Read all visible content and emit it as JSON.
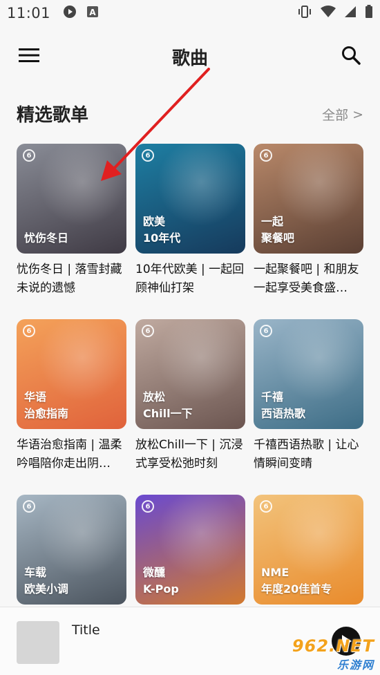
{
  "status_bar": {
    "time": "11:01",
    "icons": [
      "play-circle-icon",
      "a-badge-icon",
      "vibrate-icon",
      "wifi-icon",
      "signal-icon",
      "battery-icon"
    ]
  },
  "app_bar": {
    "title": "歌曲",
    "menu_icon": "hamburger-menu-icon",
    "search_icon": "search-icon"
  },
  "section": {
    "title": "精选歌单",
    "see_all": "全部",
    "see_all_arrow": ">"
  },
  "playlists": [
    {
      "cover_line1": "忧伤冬日",
      "cover_line2": "",
      "desc": "忧伤冬日 | 落雪封藏未说的遗憾",
      "colors": [
        "#8a8d97",
        "#3f3a44"
      ]
    },
    {
      "cover_line1": "欧美",
      "cover_line2": "10年代",
      "desc": "10年代欧美 | 一起回顾神仙打架",
      "colors": [
        "#1e7fa3",
        "#163a5c"
      ]
    },
    {
      "cover_line1": "一起",
      "cover_line2": "聚餐吧",
      "desc": "一起聚餐吧 | 和朋友一起享受美食盛…",
      "colors": [
        "#b9896a",
        "#5a3f33"
      ]
    },
    {
      "cover_line1": "华语",
      "cover_line2": "治愈指南",
      "desc": "华语治愈指南 | 温柔吟唱陪你走出阴…",
      "colors": [
        "#f4a25a",
        "#e0623b"
      ]
    },
    {
      "cover_line1": "放松",
      "cover_line2": "Chill一下",
      "desc": "放松Chill一下 | 沉浸式享受松弛时刻",
      "colors": [
        "#c0aaa0",
        "#6b5550"
      ]
    },
    {
      "cover_line1": "千禧",
      "cover_line2": "西语热歌",
      "desc": "千禧西语热歌 | 让心情瞬间变晴",
      "colors": [
        "#9ab5c8",
        "#3d6d86"
      ]
    },
    {
      "cover_line1": "车载",
      "cover_line2": "欧美小调",
      "desc": "",
      "colors": [
        "#a7b7c4",
        "#4b545e"
      ]
    },
    {
      "cover_line1": "微醺",
      "cover_line2": "K-Pop",
      "desc": "",
      "colors": [
        "#6a4ad0",
        "#d2792e"
      ]
    },
    {
      "cover_line1": "NME",
      "cover_line2": "年度20佳首专",
      "desc": "",
      "colors": [
        "#f2c37c",
        "#e98b2c"
      ]
    }
  ],
  "mini_player": {
    "title": "Title",
    "play_icon": "play-icon"
  },
  "watermark": {
    "top": "962.NET",
    "bottom": "乐游网"
  },
  "accent": "#e02020"
}
